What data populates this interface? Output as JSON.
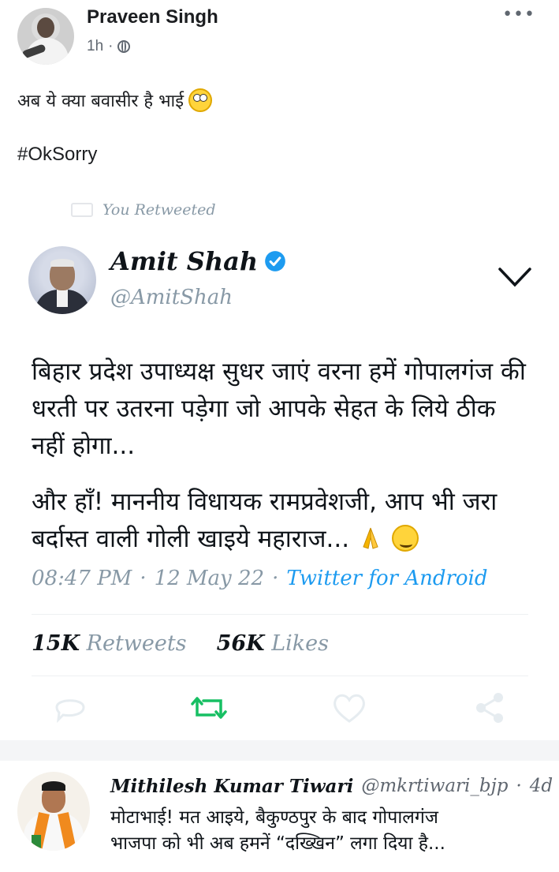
{
  "post": {
    "author": "Praveen Singh",
    "time": "1h",
    "dot": "·",
    "privacy_icon": "globe-icon",
    "more_icon": "more-dots-icon",
    "more_glyph": "•••",
    "text": "अब ये क्या बवासीर है भाई",
    "hashtag": "#OkSorry"
  },
  "tweet": {
    "retweeted_label": "You Retweeted",
    "name": "Amit Shah",
    "handle": "@AmitShah",
    "verified_icon": "verified-badge-icon",
    "body_para1": "बिहार प्रदेश उपाध्यक्ष सुधर जाएं वरना हमें गोपालगंज की धरती पर उतरना पड़ेगा जो आपके सेहत के लिये ठीक नहीं होगा...",
    "body_para2": "और हाँ! माननीय विधायक रामप्रवेशजी, आप भी जरा बर्दास्त वाली गोली खाइये महाराज...",
    "time": "08:47 PM",
    "sep": "·",
    "date": "12 May 22",
    "source": "Twitter for Android",
    "retweets_count": "15K",
    "retweets_label": "Retweets",
    "likes_count": "56K",
    "likes_label": "Likes",
    "accent_color": "#1d9bf0",
    "retweet_active_color": "#17bf63"
  },
  "reply": {
    "name": "Mithilesh Kumar Tiwari",
    "handle": "@mkrtiwari_bjp",
    "sep": "·",
    "age": "4d",
    "line1": "मोटाभाई! मत आइये, बैकुण्ठपुर के बाद गोपालगंज",
    "line2": "भाजपा को भी अब हमनें “दख्खिन” लगा दिया है..."
  }
}
